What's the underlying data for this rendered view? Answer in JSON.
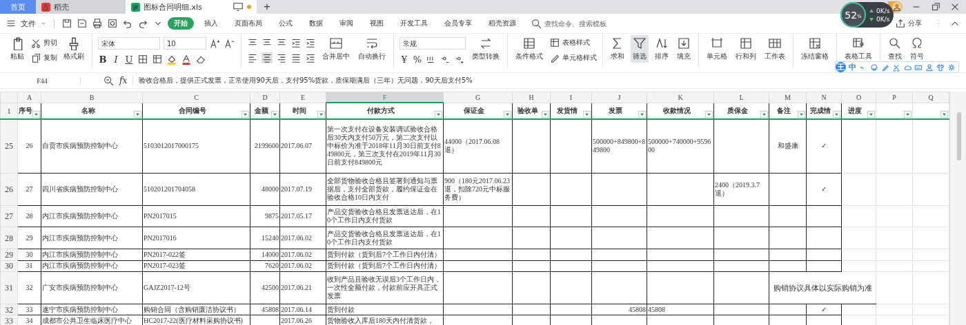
{
  "tabs": [
    {
      "label": "首页",
      "kind": "home",
      "selected": false
    },
    {
      "label": "稻壳",
      "kind": "docer",
      "selected": false
    },
    {
      "label": "图标合同明细.xls",
      "kind": "sheet",
      "selected": true
    }
  ],
  "new_tab": "+",
  "file_menu": "文件",
  "menu_tabs": [
    {
      "label": "开始",
      "selected": true
    },
    {
      "label": "插入",
      "selected": false
    },
    {
      "label": "页面布局",
      "selected": false
    },
    {
      "label": "公式",
      "selected": false
    },
    {
      "label": "数据",
      "selected": false
    },
    {
      "label": "审阅",
      "selected": false
    },
    {
      "label": "视图",
      "selected": false
    },
    {
      "label": "开发工具",
      "selected": false
    },
    {
      "label": "会员专享",
      "selected": false
    },
    {
      "label": "稻壳资源",
      "selected": false
    }
  ],
  "command_search": {
    "placeholder": "查找命令、搜索模板"
  },
  "share": "分享",
  "ribbon": {
    "paste": "粘贴",
    "cut": "剪切",
    "copy": "复制",
    "format_painter": "格式刷",
    "font": "宋体",
    "font_size": "10",
    "format_marks": [
      "B",
      "I",
      "U"
    ],
    "merge": "合并居中",
    "wrap": "自动换行",
    "number_format": "常规",
    "currency": "¥",
    "percent": "%",
    "convert": "类型转换",
    "conditional": "条件格式",
    "table_style": "表格样式",
    "cell_style": "单元格样式",
    "sum": "求和",
    "filter": {
      "label": "筛选",
      "selected": true
    },
    "sort": "排序",
    "fill": "填充",
    "cell": "单元格",
    "row_col": "行和列",
    "sheet": "工作表",
    "freeze": "冻结窗格",
    "tools": "表格工具",
    "find": "查找",
    "symbol": "符号"
  },
  "speed_widget": {
    "percent": "52",
    "unit": "%",
    "upload": "0K/s",
    "download": "0K/s"
  },
  "ime_bar": {
    "logo": "王",
    "mode": "中"
  },
  "formula_bar": {
    "name_box": "F44",
    "fx": "fx",
    "formula": "验收合格后，提供正式发票，正常使用90天后，支付95%货款，质保期满后（三年）无问题，90天后支付5%"
  },
  "columns": [
    {
      "letter": "A",
      "selected": false
    },
    {
      "letter": "B",
      "selected": false
    },
    {
      "letter": "C",
      "selected": false
    },
    {
      "letter": "D",
      "selected": false
    },
    {
      "letter": "E",
      "selected": false
    },
    {
      "letter": "F",
      "selected": true
    },
    {
      "letter": "G",
      "selected": false
    },
    {
      "letter": "H",
      "selected": false
    },
    {
      "letter": "I",
      "selected": false
    },
    {
      "letter": "J",
      "selected": false
    },
    {
      "letter": "K",
      "selected": false
    },
    {
      "letter": "L",
      "selected": false
    },
    {
      "letter": "M",
      "selected": false
    },
    {
      "letter": "N",
      "selected": false
    },
    {
      "letter": "O",
      "selected": false
    },
    {
      "letter": "P",
      "selected": false
    },
    {
      "letter": "Q",
      "selected": false
    }
  ],
  "header_row": {
    "row": "1",
    "labels": [
      "序号",
      "名称",
      "合同编号",
      "金额",
      "时间",
      "付款方式",
      "保证金",
      "验收单",
      "发货情",
      "发票",
      "收款情况",
      "质保金",
      "备注",
      "完成情",
      "进度"
    ]
  },
  "rows": [
    {
      "row": "25",
      "cells": {
        "A": "26",
        "B": "自贡市疾病预防控制中心",
        "C": "5103012017000175",
        "D": "2199600",
        "E": "2017.06.07",
        "F": "第一次支付在设备安装调试验收合格后30天内支付50万元，第二次支付以中标价为准于2018年11月30日前支付849800元，第三次支付在2019年11月30日前支付849800元",
        "G": "44000（2017.06.08退）",
        "J": "500000+849800+849800",
        "K": "500000+740000+959600",
        "M": "和盛康",
        "N": "✓"
      }
    },
    {
      "row": "26",
      "cells": {
        "A": "27",
        "B": "四川省疾病预防控制中心",
        "C": "510201201704058",
        "D": "48000",
        "E": "2017.07.19",
        "F": "全部货物验收合格且签署到通知与票据后，支付全部货款，履约保证金在验收合格10日内支付",
        "G": "900（180元2017.06.23退，扣除720元中标服务费）",
        "L": "2400（2019.3.7退）",
        "N": "✓"
      }
    },
    {
      "row": "27",
      "cells": {
        "A": "28",
        "B": "内江市疾病预防控制中心",
        "C": "PN2017015",
        "D": "9875",
        "E": "2017.05.17",
        "F": "产品交货验收合格且发票送达后，在10个工作日内支付货款"
      }
    },
    {
      "row": "28",
      "cells": {
        "A": "29",
        "B": "内江市疾病预防控制中心",
        "C": "PN2017016",
        "D": "15240",
        "E": "2017.06.02",
        "F": "产品交货验收合格且发票送达后，在10个工作日内支付货款"
      }
    },
    {
      "row": "29",
      "cells": {
        "A": "30",
        "B": "内江市疾病预防控制中心",
        "C": "PN2017-022签",
        "D": "14000",
        "E": "2017.06.02",
        "F": "货到付款（货到后7个工作日内付清）"
      }
    },
    {
      "row": "30",
      "cells": {
        "A": "31",
        "B": "内江市疾病预防控制中心",
        "C": "PN2017-023签",
        "D": "7620",
        "E": "2017.06.02",
        "F": "货到付款（货到后7个工作日内付清）"
      }
    },
    {
      "row": "31",
      "note_spans": true,
      "cells": {
        "A": "32",
        "B": "广安市疾病预防控制中心",
        "C": "GAJZ2017-12号",
        "D": "42500",
        "E": "2017.06.21",
        "F": "收到产品且验收无误后3个工作日内，一次性全额付款，付款前应开具正式发票",
        "M": "购销协议具体以实际购销为准"
      }
    },
    {
      "row": "32",
      "cells": {
        "A": "33",
        "B": "遂宁市疾病预防控制中心",
        "C": "购销合同（含购销廉洁协议书）",
        "D": "45808",
        "E": "2017.06.14",
        "F": "货到付款",
        "J": "45808",
        "K": "45808",
        "N": "✓"
      }
    },
    {
      "row": "33",
      "cells": {
        "A": "34",
        "B": "成都市公共卫生临床医疗中心",
        "C": "HC2017-22(医疗材料采购协议书)",
        "E": "2017.06.26",
        "F": "货物验收入库后180天内付清货款，"
      }
    }
  ]
}
